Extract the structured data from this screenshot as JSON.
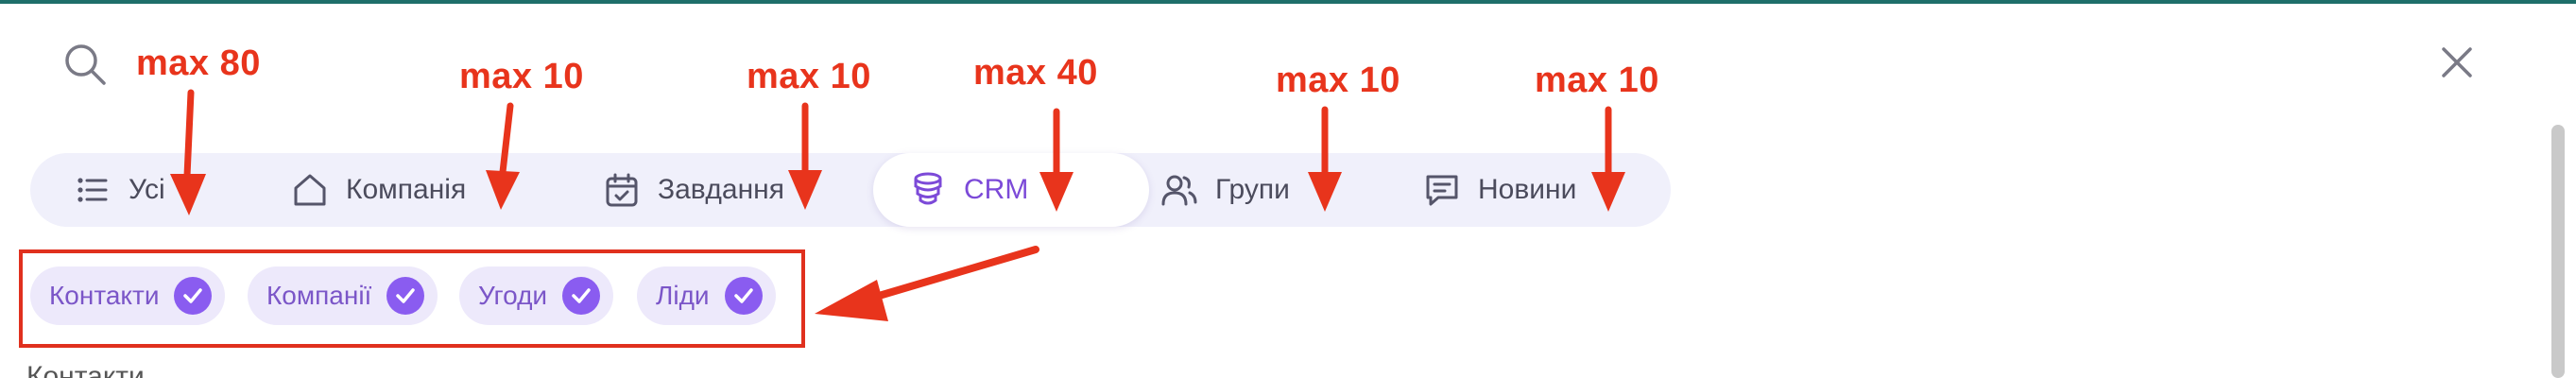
{
  "tabs": [
    {
      "label": "Усі",
      "icon": "list-icon"
    },
    {
      "label": "Компанія",
      "icon": "home-icon"
    },
    {
      "label": "Завдання",
      "icon": "calendar-check-icon"
    },
    {
      "label": "CRM",
      "icon": "database-icon",
      "active": true
    },
    {
      "label": "Групи",
      "icon": "users-icon"
    },
    {
      "label": "Новини",
      "icon": "message-icon"
    }
  ],
  "chips": [
    {
      "label": "Контакти",
      "checked": true
    },
    {
      "label": "Компанії",
      "checked": true
    },
    {
      "label": "Угоди",
      "checked": true
    },
    {
      "label": "Ліди",
      "checked": true
    }
  ],
  "annotations": [
    "max 80",
    "max 10",
    "max 10",
    "max 40",
    "max 10",
    "max 10"
  ],
  "section_heading_partial": "Контакти",
  "colors": {
    "accent": "#7c4ad8",
    "chip_bg": "#ede9fb",
    "check_bg": "#8a5cf0",
    "tabbar_bg": "#f0f0fb",
    "annotation_red": "#e8341c",
    "top_bar": "#1f6f6a"
  }
}
